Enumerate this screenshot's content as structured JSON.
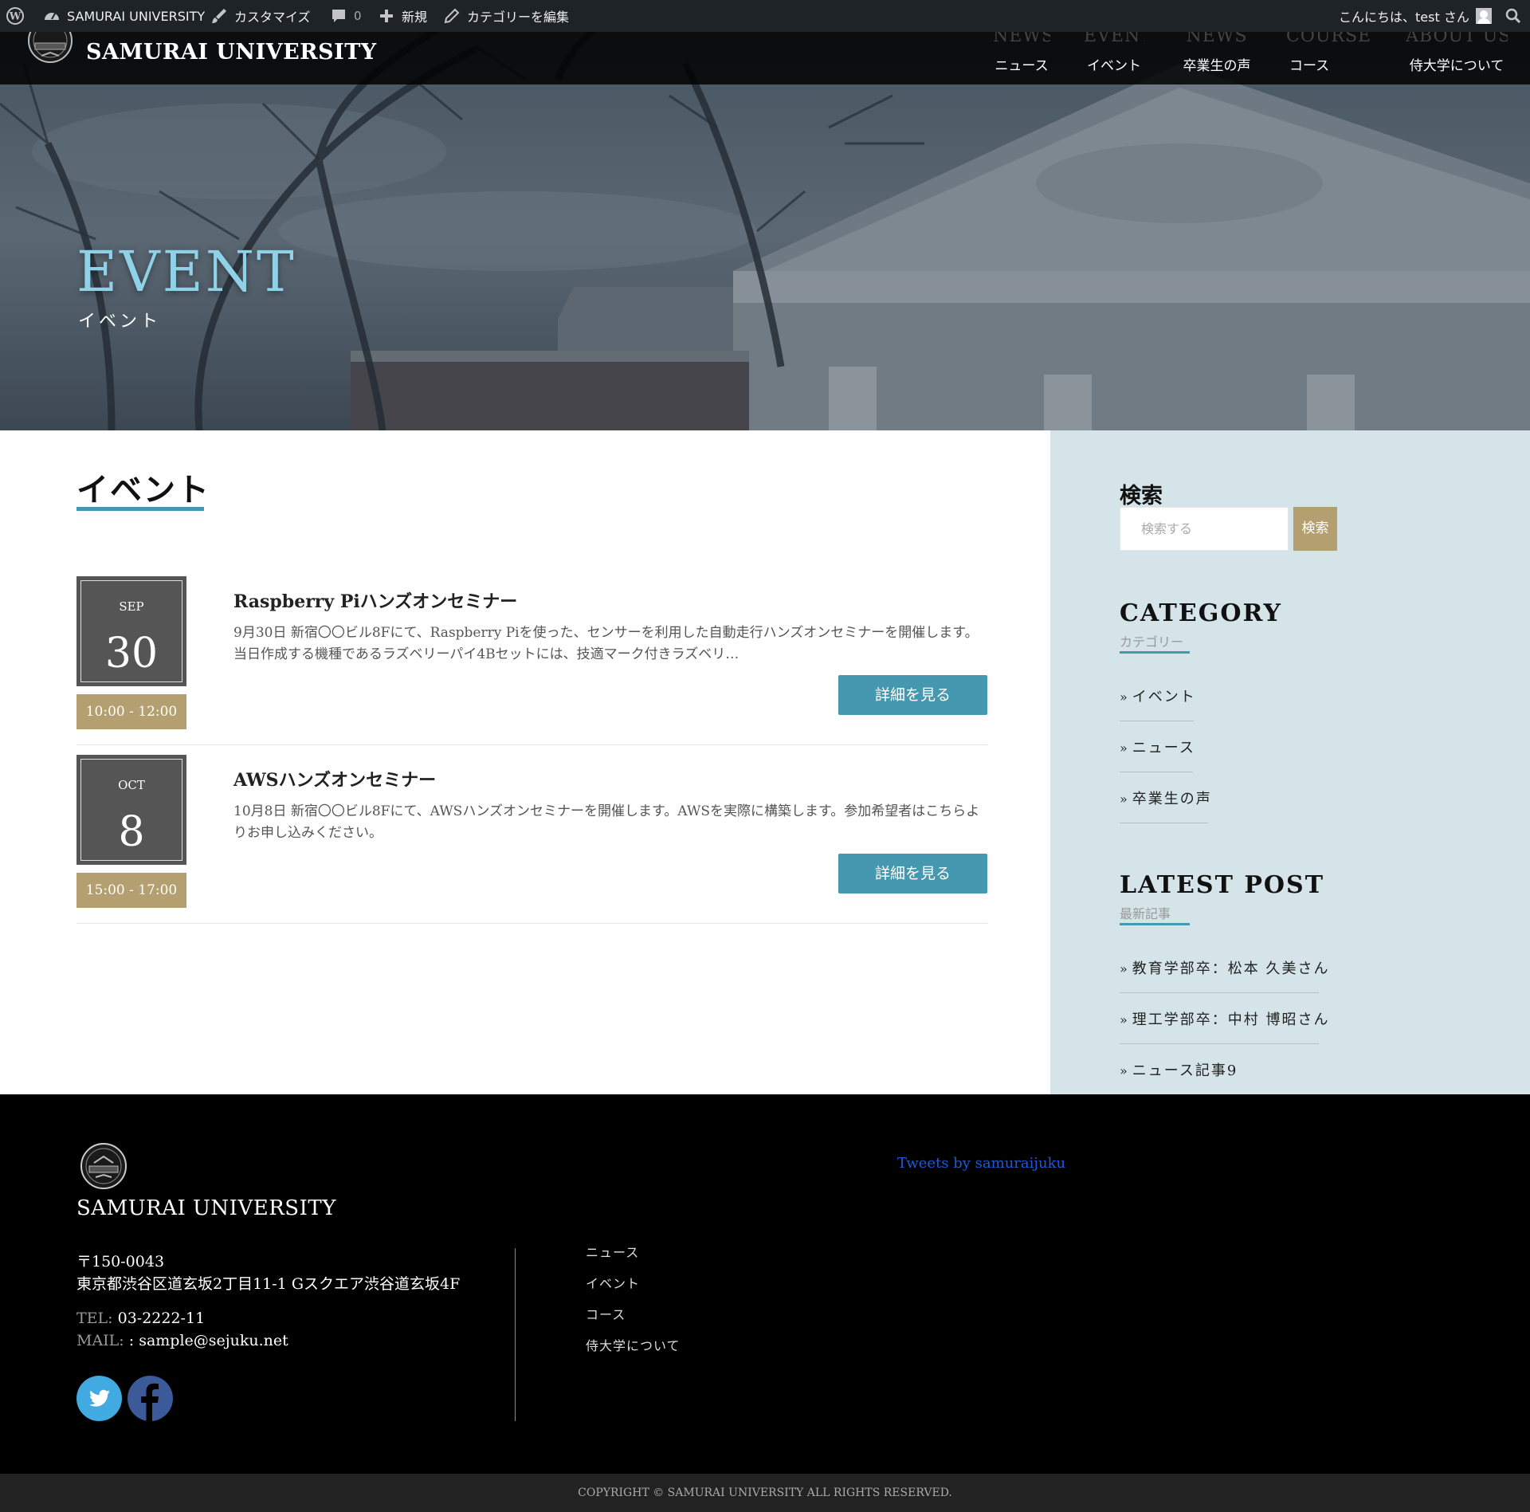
{
  "admin_bar": {
    "site_name": "SAMURAI UNIVERSITY",
    "customize": "カスタマイズ",
    "comments_count": "0",
    "new": "新規",
    "edit_category": "カテゴリーを編集",
    "greeting": "こんにちは、test さん"
  },
  "header": {
    "site_title": "SAMURAI UNIVERSITY",
    "nav": [
      {
        "en": "NEWS",
        "ja": "ニュース"
      },
      {
        "en": "EVENT",
        "ja": "イベント"
      },
      {
        "en": "NEWS",
        "ja": "卒業生の声"
      },
      {
        "en": "COURSES",
        "ja": "コース"
      },
      {
        "en": "ABOUT US",
        "ja": "侍大学について"
      }
    ]
  },
  "hero": {
    "title": "EVENT",
    "subtitle": "イベント"
  },
  "main": {
    "heading": "イベント",
    "events": [
      {
        "month": "SEP",
        "day": "30",
        "time": "10:00 - 12:00",
        "title": "Raspberry Piハンズオンセミナー",
        "description": "9月30日 新宿〇〇ビル8Fにて、Raspberry Piを使った、センサーを利用した自動走行ハンズオンセミナーを開催します。当日作成する機種であるラズベリーパイ4Bセットには、技適マーク付きラズベリ…",
        "button": "詳細を見る"
      },
      {
        "month": "OCT",
        "day": "8",
        "time": "15:00 - 17:00",
        "title": "AWSハンズオンセミナー",
        "description": "10月8日 新宿〇〇ビル8Fにて、AWSハンズオンセミナーを開催します。AWSを実際に構築します。参加希望者はこちらよりお申し込みください。",
        "button": "詳細を見る"
      }
    ]
  },
  "sidebar": {
    "search_heading": "検索",
    "search_placeholder": "検索する",
    "search_button": "検索",
    "category_heading": "CATEGORY",
    "category_sub": "カテゴリー",
    "categories": [
      "イベント",
      "ニュース",
      "卒業生の声"
    ],
    "latest_heading": "LATEST POST",
    "latest_sub": "最新記事",
    "latest_posts": [
      "教育学部卒：松本 久美さん",
      "理工学部卒：中村 博昭さん",
      "ニュース記事9"
    ],
    "chevron": "»"
  },
  "footer": {
    "title": "SAMURAI UNIVERSITY",
    "zip": "〒150-0043",
    "address": "東京都渋谷区道玄坂2丁目11-1 Gスクエア渋谷道玄坂4F",
    "tel_label": "TEL:",
    "tel": "03-2222-11",
    "mail_label": "MAIL:",
    "mail": ": sample@sejuku.net",
    "nav": [
      "ニュース",
      "イベント",
      "コース",
      "侍大学について"
    ],
    "tweets": "Tweets by samuraijuku",
    "copyright": "COPYRIGHT © SAMURAI UNIVERSITY ALL RIGHTS RESERVED."
  },
  "colors": {
    "accent_blue": "#4598b0",
    "accent_gold": "#b49f70",
    "sidebar_bg": "#d5e4e8",
    "hero_title": "#8fd1e6",
    "twitter": "#41abe1",
    "facebook": "#3c5a99"
  },
  "icons": {
    "admin": [
      "wordpress-icon",
      "dashboard-icon",
      "brush-icon",
      "comment-icon",
      "plus-icon",
      "pencil-icon",
      "avatar-icon",
      "search-icon"
    ],
    "footer": [
      "twitter-icon",
      "facebook-icon"
    ]
  }
}
